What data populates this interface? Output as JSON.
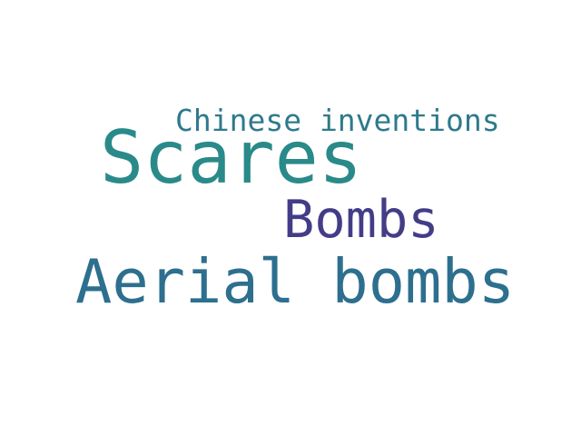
{
  "words": [
    {
      "text": "Chinese inventions",
      "color": "#2e7a8c"
    },
    {
      "text": "Scares",
      "color": "#2a8a8a"
    },
    {
      "text": "Bombs",
      "color": "#433d87"
    },
    {
      "text": "Aerial bombs",
      "color": "#2d6f8e"
    }
  ],
  "background_color": "#ffffff"
}
